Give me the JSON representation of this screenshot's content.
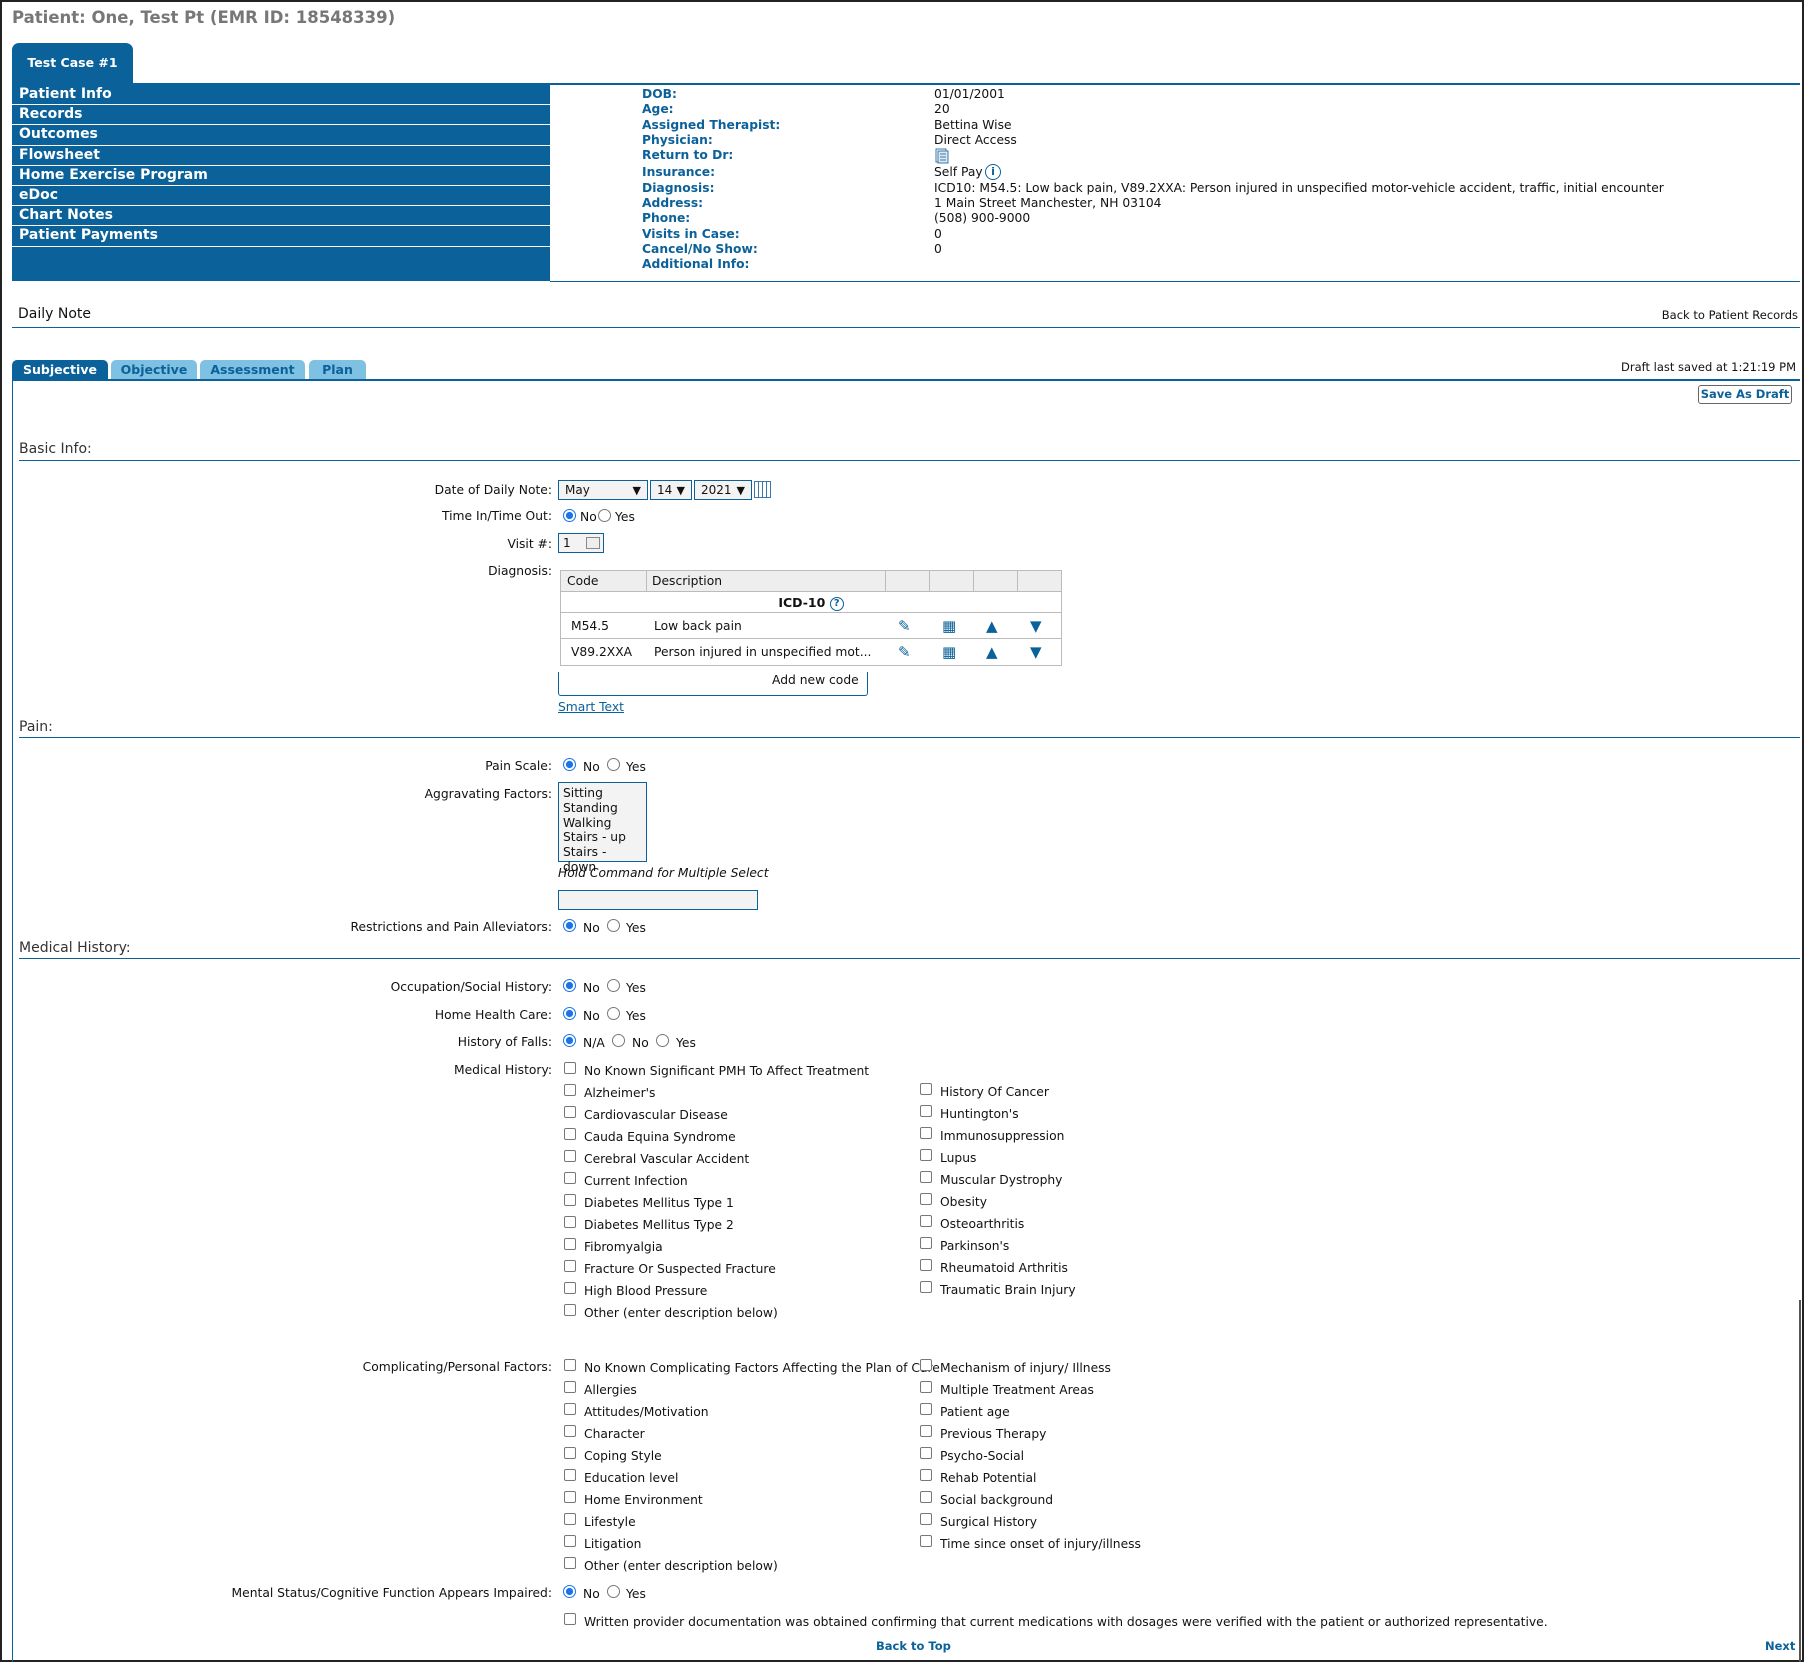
{
  "patient_header": "Patient: One, Test Pt (EMR ID: 18548339)",
  "case_tab": "Test Case #1",
  "sidebar": {
    "items": [
      {
        "label": "Patient Info"
      },
      {
        "label": "Records"
      },
      {
        "label": "Outcomes"
      },
      {
        "label": "Flowsheet"
      },
      {
        "label": "Home Exercise Program"
      },
      {
        "label": "eDoc"
      },
      {
        "label": "Chart Notes"
      },
      {
        "label": "Patient Payments"
      }
    ]
  },
  "patient_info": [
    {
      "key": "DOB:",
      "value": "01/01/2001"
    },
    {
      "key": "Age:",
      "value": "20"
    },
    {
      "key": "Assigned Therapist:",
      "value": "Bettina Wise"
    },
    {
      "key": "Physician:",
      "value": "Direct Access"
    },
    {
      "key": "Return to Dr:",
      "value": ""
    },
    {
      "key": "Insurance:",
      "value": "Self Pay"
    },
    {
      "key": "Diagnosis:",
      "value": "ICD10: M54.5: Low back pain, V89.2XXA: Person injured in unspecified motor-vehicle accident, traffic, initial encounter"
    },
    {
      "key": "Address:",
      "value": "1 Main Street Manchester, NH 03104"
    },
    {
      "key": "Phone:",
      "value": "(508) 900-9000"
    },
    {
      "key": "Visits in Case:",
      "value": "0"
    },
    {
      "key": "Cancel/No Show:",
      "value": "0"
    },
    {
      "key": "Additional Info:",
      "value": ""
    }
  ],
  "note": {
    "title": "Daily Note",
    "back_link": "Back to Patient Records",
    "draft_saved": "Draft last saved at 1:21:19 PM",
    "save_draft": "Save As Draft"
  },
  "tabs": [
    {
      "label": "Subjective"
    },
    {
      "label": "Objective"
    },
    {
      "label": "Assessment"
    },
    {
      "label": "Plan"
    }
  ],
  "basic_info": {
    "heading": "Basic Info:",
    "date_label": "Date of Daily Note:",
    "month": "May",
    "day": "14",
    "year": "2021",
    "time_label": "Time In/Time Out:",
    "visit_label": "Visit #:",
    "visit_value": "1",
    "diagnosis_label": "Diagnosis:",
    "dx_head_code": "Code",
    "dx_head_desc": "Description",
    "dx_group": "ICD-10",
    "dx_rows": [
      {
        "code": "M54.5",
        "desc": "Low back pain"
      },
      {
        "code": "V89.2XXA",
        "desc": "Person injured in unspecified mot..."
      }
    ],
    "add_code": "Add new code",
    "smart_text": "Smart Text"
  },
  "radio_labels": {
    "no": "No",
    "yes": "Yes",
    "na": "N/A"
  },
  "pain": {
    "heading": "Pain:",
    "scale_label": "Pain Scale:",
    "aggravating_label": "Aggravating Factors:",
    "aggravating_options": [
      "Sitting",
      "Standing",
      "Walking",
      "Stairs - up",
      "Stairs - down"
    ],
    "hold_hint": "Hold Command for Multiple Select",
    "restrictions_label": "Restrictions and Pain Alleviators:"
  },
  "medical": {
    "heading": "Medical History:",
    "occupation_label": "Occupation/Social History:",
    "home_health_label": "Home Health Care:",
    "falls_label": "History of Falls:",
    "history_label": "Medical History:",
    "history_first": "No Known Significant PMH To Affect Treatment",
    "history_left": [
      "Alzheimer's",
      "Cardiovascular Disease",
      "Cauda Equina Syndrome",
      "Cerebral Vascular Accident",
      "Current Infection",
      "Diabetes Mellitus Type 1",
      "Diabetes Mellitus Type 2",
      "Fibromyalgia",
      "Fracture Or Suspected Fracture",
      "High Blood Pressure",
      "Other (enter description below)"
    ],
    "history_right": [
      "History Of Cancer",
      "Huntington's",
      "Immunosuppression",
      "Lupus",
      "Muscular Dystrophy",
      "Obesity",
      "Osteoarthritis",
      "Parkinson's",
      "Rheumatoid Arthritis",
      "Traumatic Brain Injury"
    ],
    "complicating_label": "Complicating/Personal Factors:",
    "comp_left": [
      "No Known Complicating Factors Affecting the Plan of Care",
      "Allergies",
      "Attitudes/Motivation",
      "Character",
      "Coping Style",
      "Education level",
      "Home Environment",
      "Lifestyle",
      "Litigation",
      "Other (enter description below)"
    ],
    "comp_right": [
      "Mechanism of injury/ Illness",
      "Multiple Treatment Areas",
      "Patient age",
      "Previous Therapy",
      "Psycho-Social",
      "Rehab Potential",
      "Social background",
      "Surgical History",
      "Time since onset of injury/illness"
    ],
    "mental_label": "Mental Status/Cognitive Function Appears Impaired:",
    "written_doc": "Written provider documentation was obtained confirming that current medications with dosages were verified with the patient or authorized representative."
  },
  "footer": {
    "back_to_top": "Back to Top",
    "next": "Next"
  }
}
